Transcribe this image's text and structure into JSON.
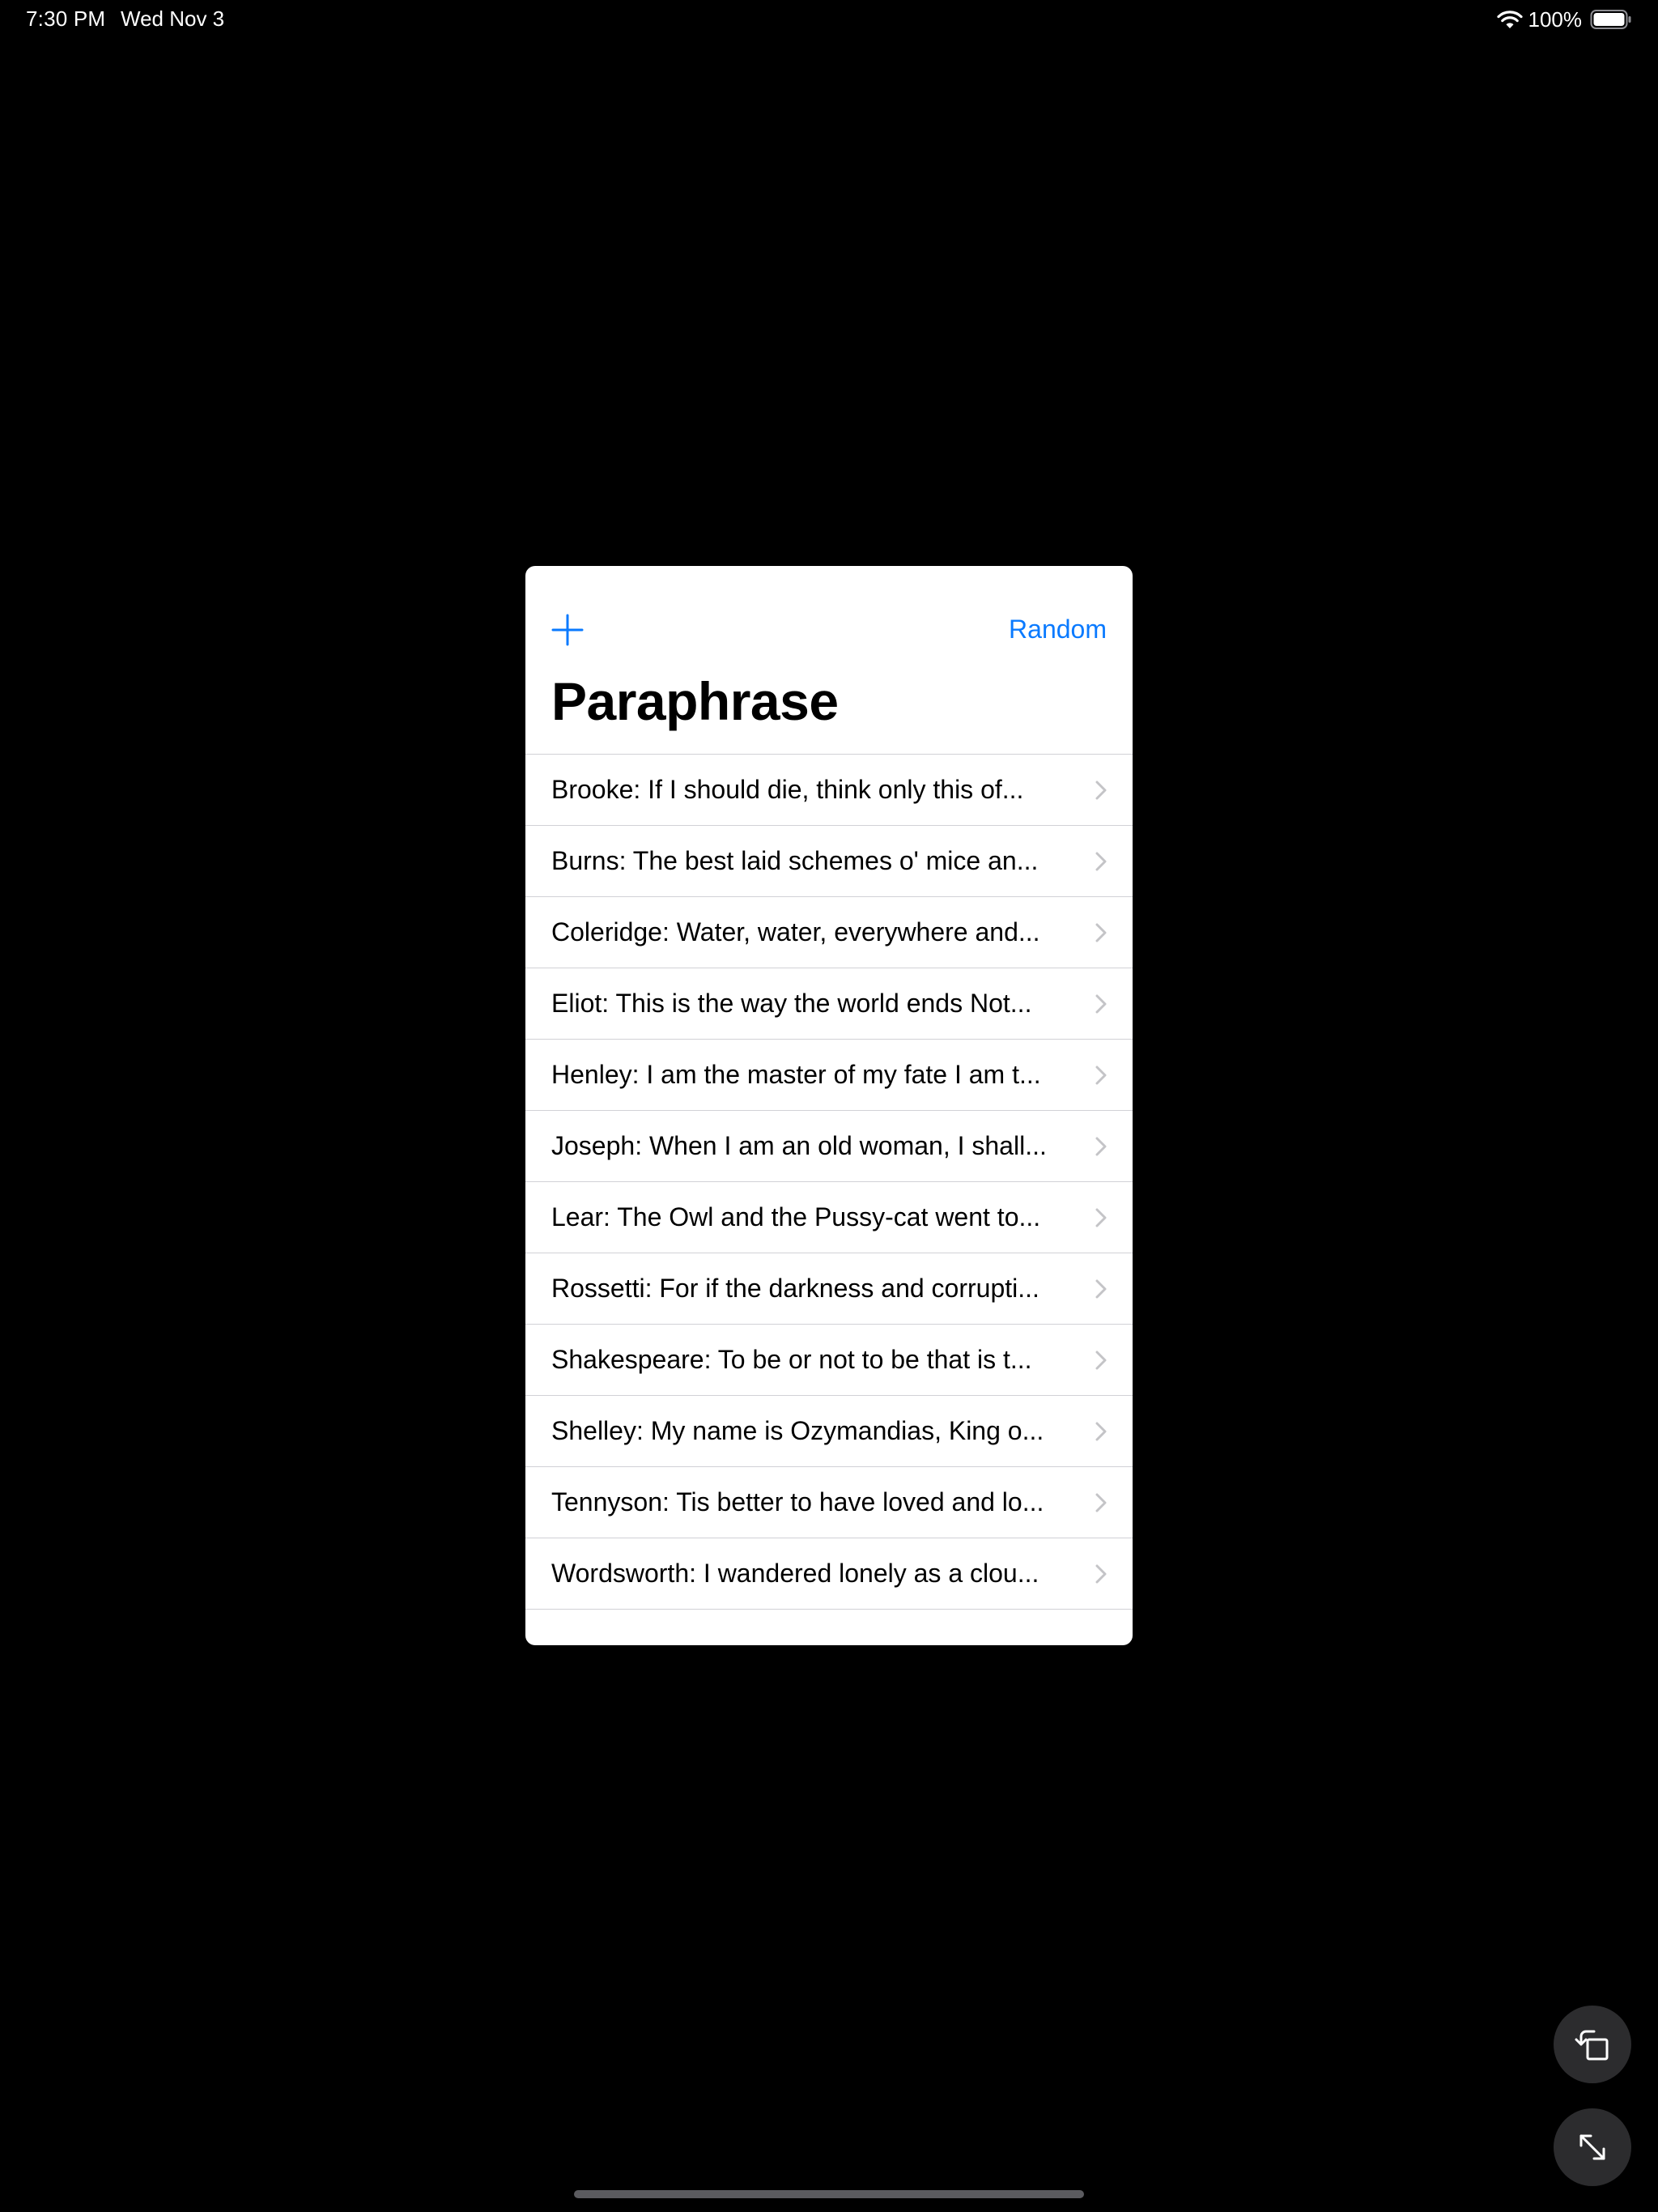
{
  "status_bar": {
    "time": "7:30 PM",
    "date": "Wed Nov 3",
    "battery_percent": "100%",
    "wifi_icon": "wifi-icon",
    "battery_icon": "battery-icon"
  },
  "app": {
    "add_icon": "plus-icon",
    "random_label": "Random",
    "title": "Paraphrase",
    "accent_color": "#0a7aff",
    "items": [
      {
        "label": "Brooke: If I should die, think only this of..."
      },
      {
        "label": "Burns: The best laid schemes o' mice an..."
      },
      {
        "label": "Coleridge: Water, water, everywhere and..."
      },
      {
        "label": "Eliot: This is the way the world ends Not..."
      },
      {
        "label": "Henley: I am the master of my fate I am t..."
      },
      {
        "label": "Joseph: When I am an old woman, I shall..."
      },
      {
        "label": "Lear: The Owl and the Pussy-cat went to..."
      },
      {
        "label": "Rossetti: For if the darkness and corrupti..."
      },
      {
        "label": "Shakespeare: To be or not to be that is t..."
      },
      {
        "label": "Shelley: My name is Ozymandias, King o..."
      },
      {
        "label": "Tennyson: Tis better to have loved and lo..."
      },
      {
        "label": "Wordsworth: I wandered lonely as a clou..."
      }
    ]
  },
  "controls": {
    "rotate_icon": "rotate-icon",
    "fullscreen_icon": "expand-icon"
  }
}
